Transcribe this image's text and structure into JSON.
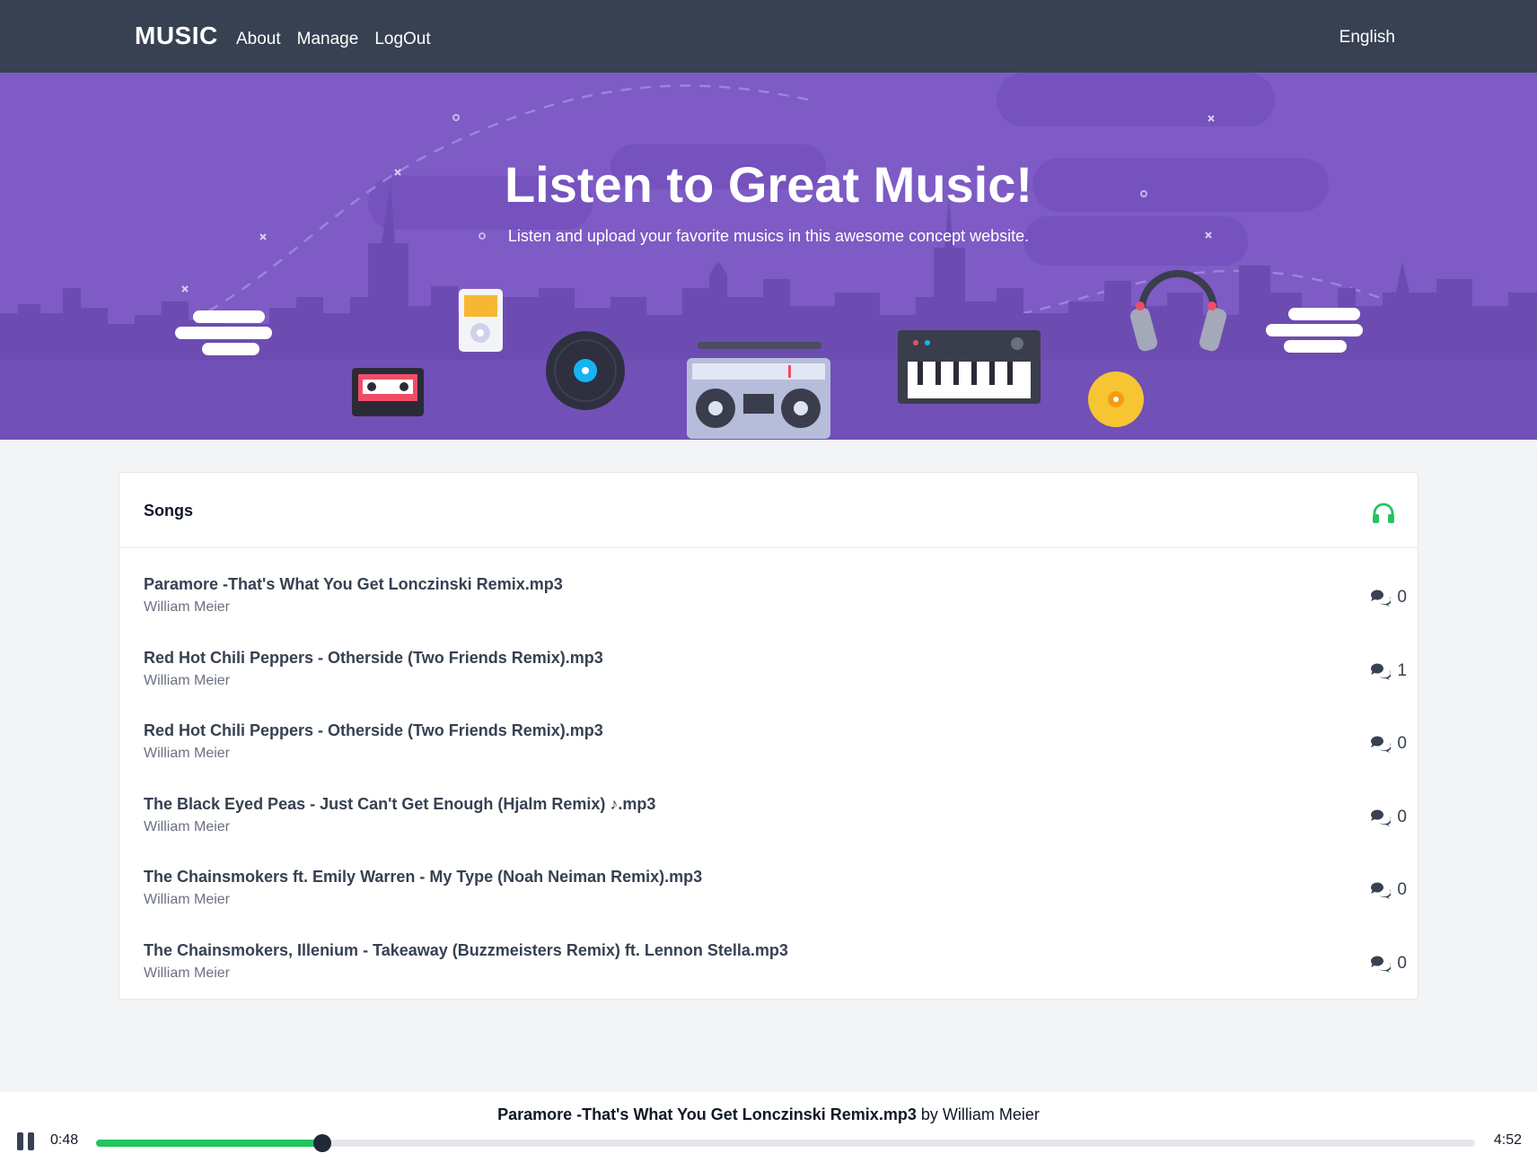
{
  "navbar": {
    "brand": "MUSIC",
    "links": [
      "About",
      "Manage",
      "LogOut"
    ],
    "language": "English",
    "background": "#374151"
  },
  "hero": {
    "title": "Listen to Great Music!",
    "subtitle": "Listen and upload your favorite musics in this awesome concept website.",
    "background": "#7e5bc5"
  },
  "songs_card": {
    "title": "Songs",
    "header_icon": "headphones-icon",
    "accent": "#22c55e",
    "items": [
      {
        "title": "Paramore -That's What You Get Lonczinski Remix.mp3",
        "artist": "William Meier",
        "comments": "0"
      },
      {
        "title": "Red Hot Chili Peppers - Otherside (Two Friends Remix).mp3",
        "artist": "William Meier",
        "comments": "1"
      },
      {
        "title": "Red Hot Chili Peppers - Otherside (Two Friends Remix).mp3",
        "artist": "William Meier",
        "comments": "0"
      },
      {
        "title": "The Black Eyed Peas - Just Can't Get Enough (Hjalm Remix) ♪.mp3",
        "artist": "William Meier",
        "comments": "0"
      },
      {
        "title": "The Chainsmokers ft. Emily Warren - My Type (Noah Neiman Remix).mp3",
        "artist": "William Meier",
        "comments": "0"
      },
      {
        "title": "The Chainsmokers, Illenium - Takeaway (Buzzmeisters Remix) ft. Lennon Stella.mp3",
        "artist": "William Meier",
        "comments": "0"
      }
    ]
  },
  "player": {
    "title": "Paramore -That's What You Get Lonczinski Remix.mp3",
    "by_label": "by",
    "artist": "William Meier",
    "current_time": "0:48",
    "total_time": "4:52",
    "progress": 0.164,
    "state_icon": "pause-icon"
  }
}
